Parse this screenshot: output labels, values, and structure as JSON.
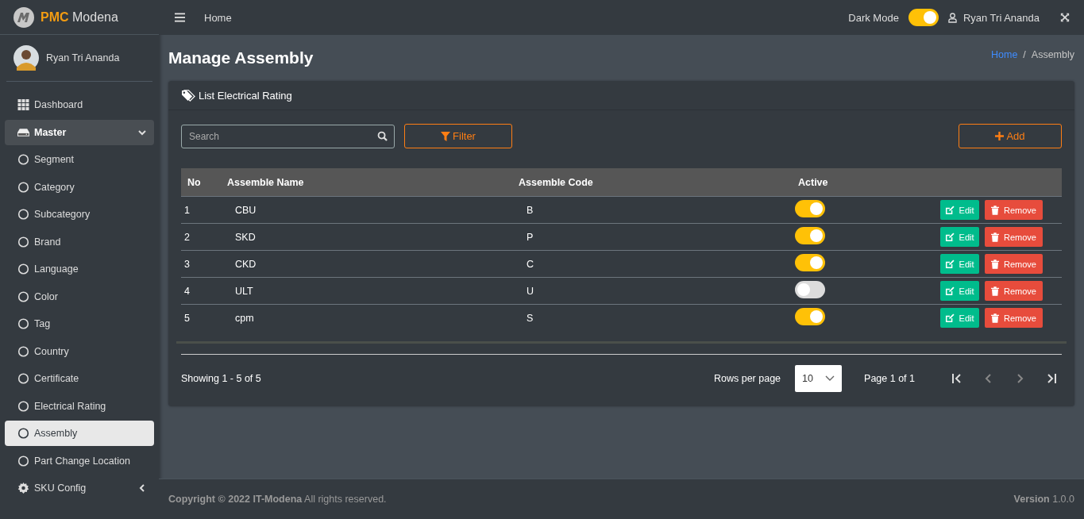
{
  "brand": {
    "accent": "PMC",
    "name": "Modena"
  },
  "topbar": {
    "home": "Home",
    "dark_mode": {
      "label": "Dark Mode",
      "on": true
    },
    "user": "Ryan Tri Ananda"
  },
  "sidebar": {
    "user": "Ryan Tri Ananda",
    "items": [
      {
        "kind": "link",
        "label": "Dashboard",
        "selected": false
      },
      {
        "kind": "group",
        "label": "Master",
        "expanded": true,
        "selected": false,
        "children": [
          {
            "label": "Segment",
            "selected": false
          },
          {
            "label": "Category",
            "selected": false
          },
          {
            "label": "Subcategory",
            "selected": false
          },
          {
            "label": "Brand",
            "selected": false
          },
          {
            "label": "Language",
            "selected": false
          },
          {
            "label": "Color",
            "selected": false
          },
          {
            "label": "Tag",
            "selected": false
          },
          {
            "label": "Country",
            "selected": false
          },
          {
            "label": "Certificate",
            "selected": false
          },
          {
            "label": "Electrical Rating",
            "selected": false
          },
          {
            "label": "Assembly",
            "selected": true
          },
          {
            "label": "Part Change Location",
            "selected": false
          }
        ]
      },
      {
        "kind": "group",
        "label": "SKU Config",
        "expanded": false,
        "selected": false
      }
    ]
  },
  "page": {
    "title": "Manage Assembly",
    "breadcrumb": [
      {
        "label": "Home",
        "kind": "link"
      },
      {
        "label": "/",
        "kind": "separator"
      },
      {
        "label": "Assembly",
        "kind": "current"
      }
    ]
  },
  "card": {
    "title": "List Electrical Rating",
    "search": {
      "placeholder": "Search"
    },
    "filter": "Filter",
    "add": "Add",
    "table": {
      "columns": [
        "No",
        "Assemble Name",
        "Assemble Code",
        "Active"
      ],
      "rows": [
        {
          "no": "1",
          "name": "CBU",
          "code": "B",
          "active": true,
          "edit": "Edit",
          "remove": "Remove"
        },
        {
          "no": "2",
          "name": "SKD",
          "code": "P",
          "active": true,
          "edit": "Edit",
          "remove": "Remove"
        },
        {
          "no": "3",
          "name": "CKD",
          "code": "C",
          "active": true,
          "edit": "Edit",
          "remove": "Remove"
        },
        {
          "no": "4",
          "name": "ULT",
          "code": "U",
          "active": false,
          "edit": "Edit",
          "remove": "Remove"
        },
        {
          "no": "5",
          "name": "cpm",
          "code": "S",
          "active": true,
          "edit": "Edit",
          "remove": "Remove"
        }
      ]
    },
    "pagination": {
      "showing": "Showing 1 - 5 of 5",
      "rows_label": "Rows per page",
      "rows_value": "10",
      "page": "Page 1 of 1",
      "buttons": [
        {
          "kind": "first",
          "disabled": false
        },
        {
          "kind": "prev",
          "disabled": true
        },
        {
          "kind": "next",
          "disabled": true
        },
        {
          "kind": "last",
          "disabled": false
        }
      ]
    }
  },
  "footer": {
    "copyright": "Copyright © 2022 IT-Modena",
    "rights": "All rights reserved.",
    "version_label": "Version",
    "version": "1.0.0"
  }
}
